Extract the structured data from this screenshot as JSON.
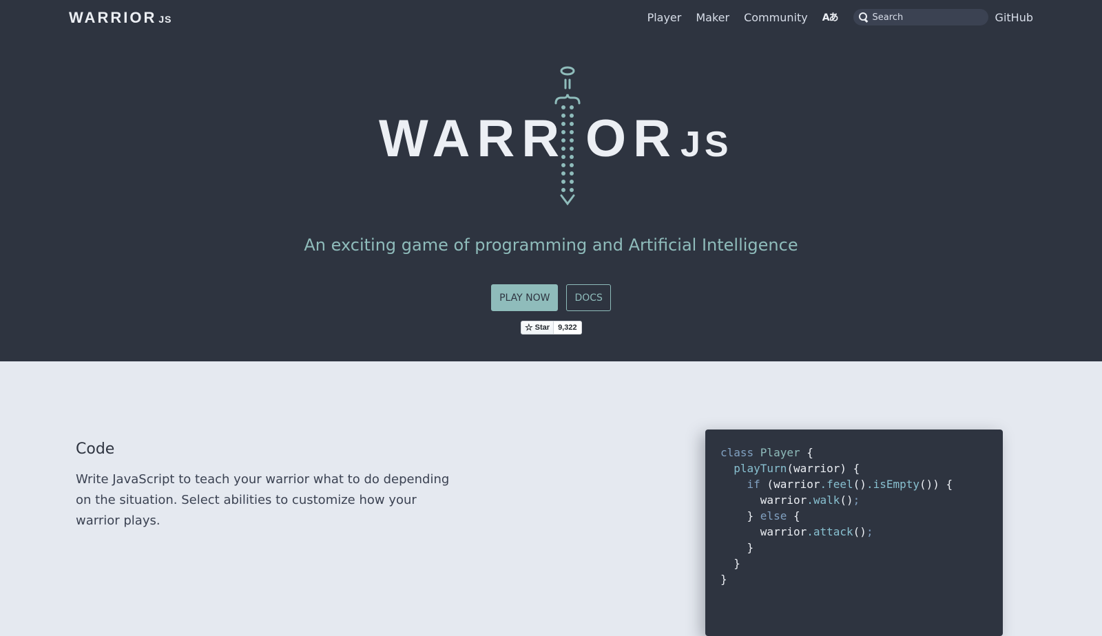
{
  "brand": {
    "name": "WARRIOR",
    "suffix": "JS"
  },
  "nav": {
    "links": [
      "Player",
      "Maker",
      "Community"
    ],
    "language_icon": "translate-icon",
    "language_label": "Aあ",
    "search_placeholder": "Search",
    "github": "GitHub"
  },
  "hero": {
    "logo_left": "WARR",
    "logo_right": "OR",
    "logo_suffix": "JS",
    "subtitle": "An exciting game of programming and Artificial Intelligence",
    "play_button": "PLAY NOW",
    "docs_button": "DOCS",
    "star_label": "Star",
    "star_count": "9,322"
  },
  "feature": {
    "title": "Code",
    "description": "Write JavaScript to teach your warrior what to do depending on the situation. Select abilities to customize how your warrior plays."
  },
  "code": {
    "lines": [
      [
        {
          "t": "class ",
          "c": "kw"
        },
        {
          "t": "Player",
          "c": "cls"
        },
        {
          "t": " {",
          "c": ""
        }
      ],
      [
        {
          "t": "  ",
          "c": ""
        },
        {
          "t": "playTurn",
          "c": "fn"
        },
        {
          "t": "(warrior) {",
          "c": ""
        }
      ],
      [
        {
          "t": "    ",
          "c": ""
        },
        {
          "t": "if",
          "c": "kw"
        },
        {
          "t": " (warrior",
          "c": ""
        },
        {
          "t": ".feel",
          "c": "fn"
        },
        {
          "t": "()",
          "c": ""
        },
        {
          "t": ".isEmpty",
          "c": "fn"
        },
        {
          "t": "()) {",
          "c": ""
        }
      ],
      [
        {
          "t": "      warrior",
          "c": ""
        },
        {
          "t": ".walk",
          "c": "fn"
        },
        {
          "t": "()",
          "c": ""
        },
        {
          "t": ";",
          "c": "pn"
        }
      ],
      [
        {
          "t": "    } ",
          "c": ""
        },
        {
          "t": "else",
          "c": "kw"
        },
        {
          "t": " {",
          "c": ""
        }
      ],
      [
        {
          "t": "      warrior",
          "c": ""
        },
        {
          "t": ".attack",
          "c": "fn"
        },
        {
          "t": "()",
          "c": ""
        },
        {
          "t": ";",
          "c": "pn"
        }
      ],
      [
        {
          "t": "    }",
          "c": ""
        }
      ],
      [
        {
          "t": "  }",
          "c": ""
        }
      ],
      [
        {
          "t": "}",
          "c": ""
        }
      ]
    ]
  },
  "colors": {
    "hero_bg": "#2e3440",
    "page_bg": "#e5e9f0",
    "accent": "#8fbcbb",
    "text_light": "#eceff4"
  }
}
